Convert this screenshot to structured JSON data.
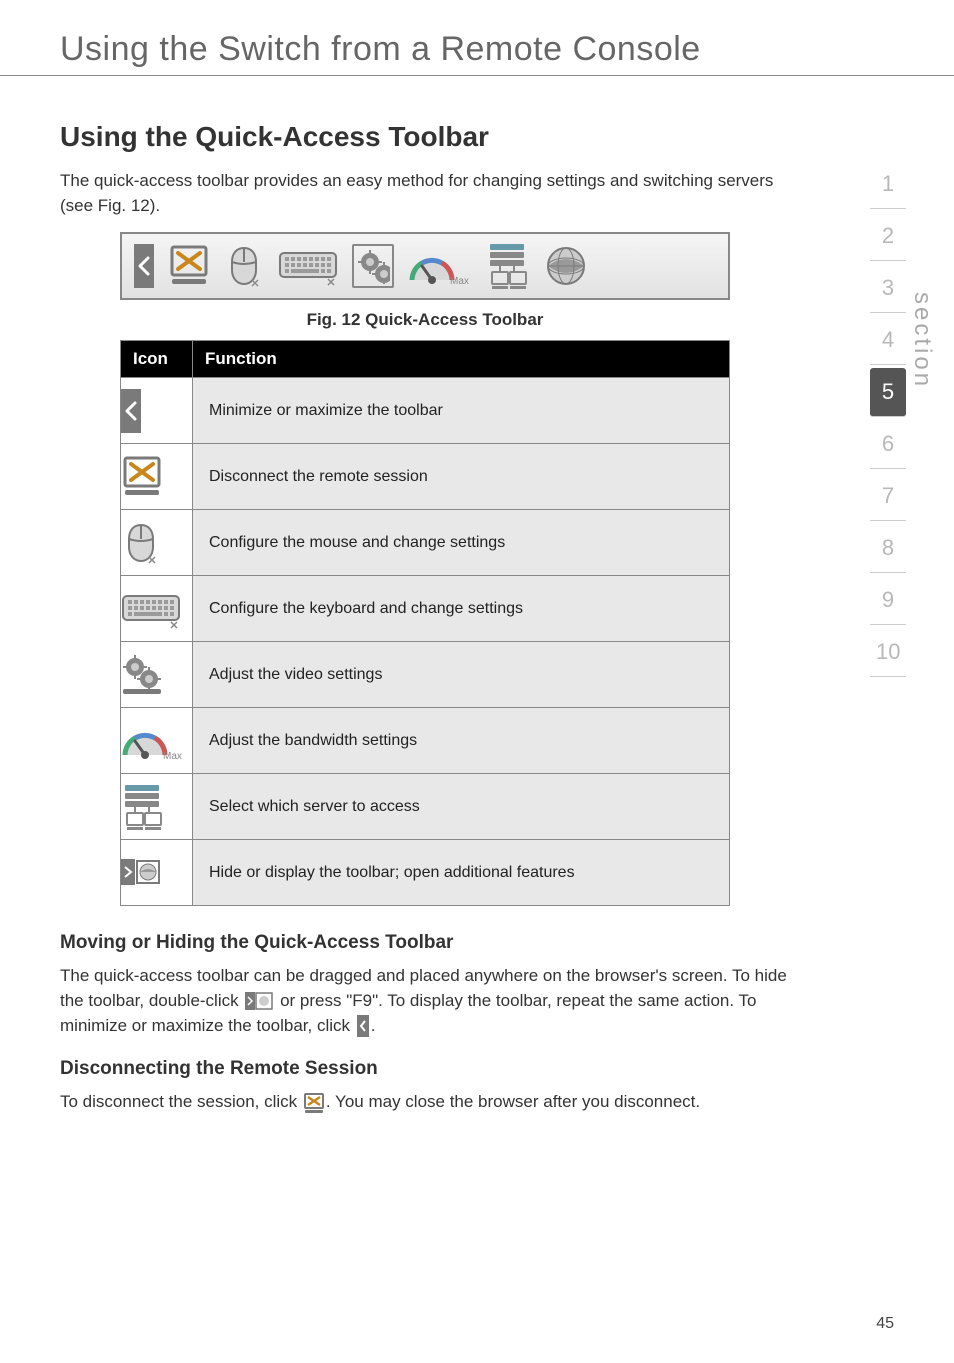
{
  "page": {
    "title": "Using the Switch from a Remote Console",
    "number": "45"
  },
  "headings": {
    "main": "Using the Quick-Access Toolbar",
    "moving": "Moving or Hiding the Quick-Access Toolbar",
    "disconnect": "Disconnecting the Remote Session"
  },
  "paragraphs": {
    "intro": "The quick-access toolbar provides an easy method for changing settings and switching servers (see Fig. 12).",
    "moving1": "The quick-access toolbar can be dragged and placed anywhere on the browser's screen. To hide the toolbar, double-click ",
    "moving2": " or press \"F9\". To display the toolbar, repeat the same action. To minimize or maximize the toolbar, click ",
    "moving3": ".",
    "disconnect1": "To disconnect the session, click ",
    "disconnect2": ". You may close the browser after you disconnect."
  },
  "figure": {
    "caption": "Fig. 12 Quick-Access Toolbar",
    "max_label": "Max"
  },
  "table": {
    "headers": {
      "icon": "Icon",
      "function": "Function"
    },
    "rows": [
      {
        "icon": "minimize-arrow",
        "desc": "Minimize or maximize the toolbar"
      },
      {
        "icon": "disconnect-x",
        "desc": "Disconnect the remote session"
      },
      {
        "icon": "mouse",
        "desc": "Configure the mouse and change settings"
      },
      {
        "icon": "keyboard",
        "desc": "Configure the keyboard and change settings"
      },
      {
        "icon": "video-gears",
        "desc": "Adjust the video settings"
      },
      {
        "icon": "bandwidth-dial",
        "desc": "Adjust the bandwidth settings"
      },
      {
        "icon": "servers",
        "desc": "Select which server to access"
      },
      {
        "icon": "globe",
        "desc": "Hide or display the toolbar; open additional features"
      }
    ]
  },
  "tabs": {
    "items": [
      "1",
      "2",
      "3",
      "4",
      "5",
      "6",
      "7",
      "8",
      "9",
      "10"
    ],
    "active_index": 4,
    "label": "section"
  }
}
